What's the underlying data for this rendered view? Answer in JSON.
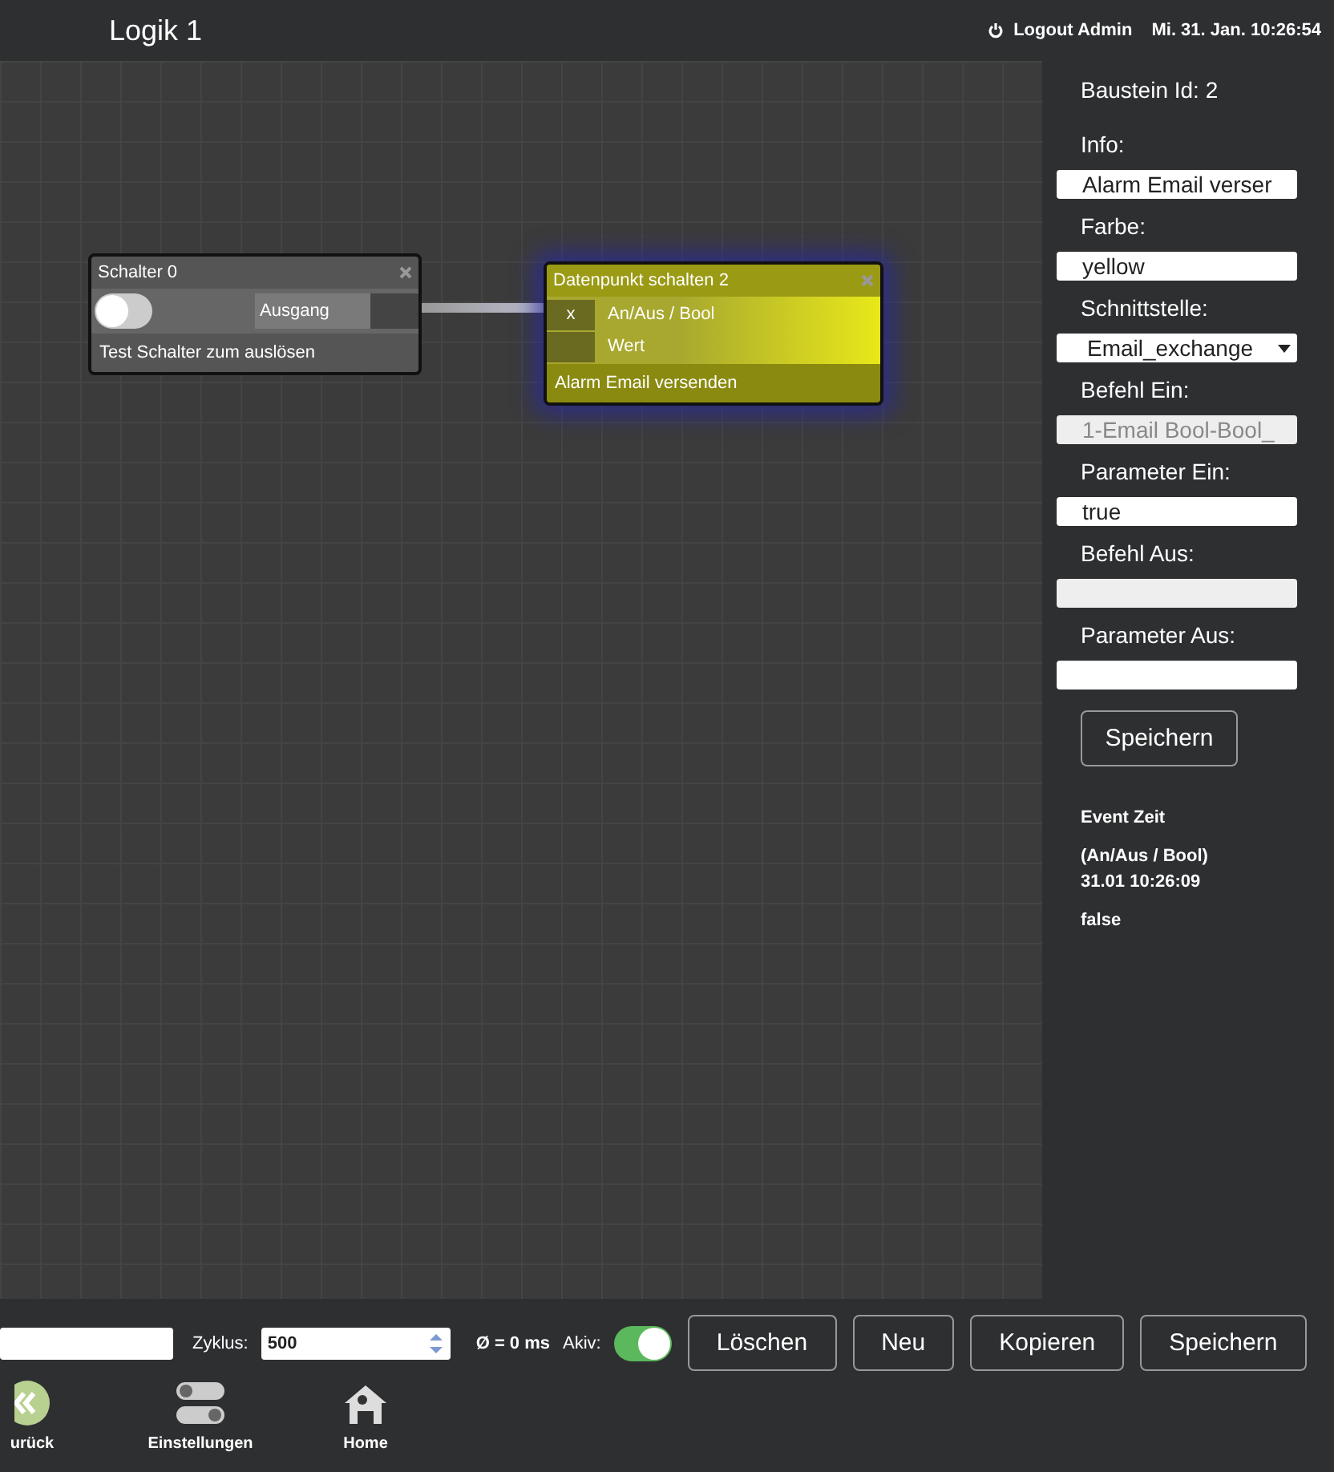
{
  "header": {
    "title": "Logik 1",
    "logout": "Logout Admin",
    "datetime": "Mi. 31. Jan. 10:26:54"
  },
  "nodes": [
    {
      "kind": "switch",
      "title": "Schalter 0",
      "selected": false,
      "on": false,
      "output": "Ausgang",
      "info": "Test Schalter zum auslösen"
    },
    {
      "kind": "datapoint",
      "title": "Datenpunkt schalten 2",
      "selected": true,
      "color": "#e8e81a",
      "inputs": [
        {
          "mark": "x",
          "label": "An/Aus / Bool"
        },
        {
          "label": "Wert"
        }
      ],
      "info": "Alarm Email versenden"
    }
  ],
  "panel": {
    "id_label": "Baustein Id: 2",
    "fields": [
      {
        "label": "Info:",
        "kind": "text",
        "value": "Alarm Email verser"
      },
      {
        "label": "Farbe:",
        "kind": "text",
        "value": "yellow"
      },
      {
        "label": "Schnittstelle:",
        "kind": "select",
        "value": "Email_exchange"
      },
      {
        "label": "Befehl Ein:",
        "kind": "readonly",
        "value": "1-Email Bool-Bool_"
      },
      {
        "label": "Parameter Ein:",
        "kind": "text",
        "value": "true"
      },
      {
        "label": "Befehl Aus:",
        "kind": "readonly"
      },
      {
        "label": "Parameter Aus:",
        "kind": "text"
      }
    ],
    "save": "Speichern",
    "event_title": "Event Zeit",
    "event_time": "(An/Aus / Bool) 31.01 10:26:09",
    "event_value": "false"
  },
  "footer": {
    "cycle_label": "Zyklus:",
    "cycle_value": "500",
    "average": "Ø = 0 ms",
    "active_label": "Akiv:",
    "active": true,
    "buttons": [
      "Löschen",
      "Neu",
      "Kopieren",
      "Speichern"
    ],
    "nav": [
      {
        "kind": "back",
        "label": "urück"
      },
      {
        "kind": "settings",
        "label": "Einstellungen"
      },
      {
        "kind": "home",
        "label": "Home"
      }
    ]
  }
}
